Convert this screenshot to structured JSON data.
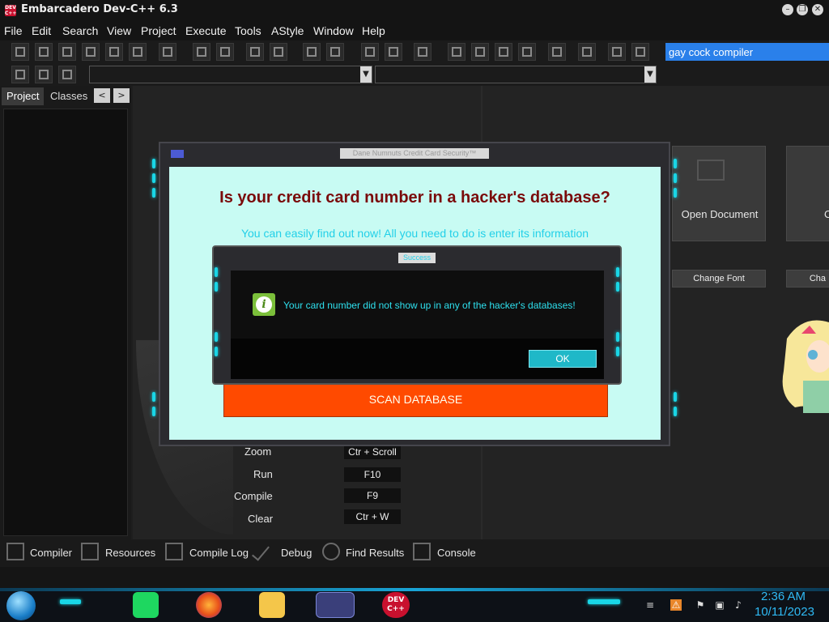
{
  "window": {
    "title": "Embarcadero Dev-C++ 6.3",
    "icon_label": "DEV C++"
  },
  "menu": [
    "File",
    "Edit",
    "Search",
    "View",
    "Project",
    "Execute",
    "Tools",
    "AStyle",
    "Window",
    "Help"
  ],
  "toolbar": {
    "search_value": "gay cock compiler"
  },
  "left_panel": {
    "tabs": [
      "Project",
      "Classes"
    ],
    "prev_label": "<",
    "next_label": ">"
  },
  "welcome": {
    "tiles": [
      {
        "label": "Open Document"
      },
      {
        "label": "C"
      }
    ],
    "buttons": [
      {
        "label": "Change Font"
      },
      {
        "label": "Cha"
      }
    ],
    "shortcuts": [
      {
        "label": "Zoom",
        "key": "Ctr + Scroll"
      },
      {
        "label": "Run",
        "key": "F10"
      },
      {
        "label": "Compile",
        "key": "F9"
      },
      {
        "label": "Clear",
        "key": "Ctr + W"
      }
    ]
  },
  "bottom_tabs": [
    "Compiler",
    "Resources",
    "Compile Log",
    "Debug",
    "Find Results",
    "Console"
  ],
  "main_dialog": {
    "title": "Dane Numnuts Credit Card Security™",
    "heading": "Is your credit card number in a hacker's database?",
    "subtitle": "You can easily find out now! All you need to do is enter its information",
    "scan_label": "SCAN DATABASE"
  },
  "success_dialog": {
    "title": "Success",
    "message": "Your card number did not show up in any of the hacker's databases!",
    "ok_label": "OK"
  },
  "taskbar": {
    "time": "2:36 AM",
    "date": "10/11/2023",
    "devcpp_label": "DEV C++"
  },
  "colors": {
    "accent_cyan": "#19d6e6",
    "scan_orange": "#ff4a00",
    "dialog_bg": "#c8fbf3",
    "heading_red": "#7a0a0a"
  }
}
